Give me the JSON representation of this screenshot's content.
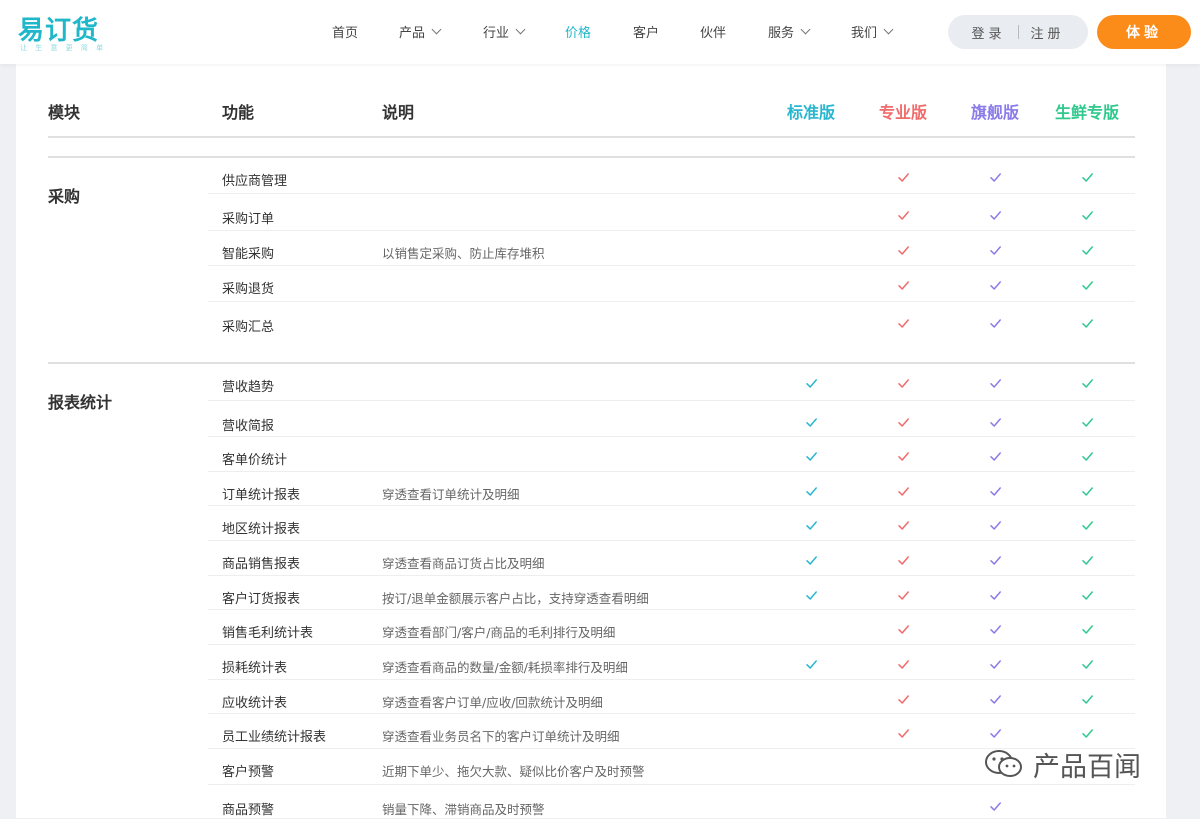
{
  "header": {
    "logo_text": "易订货",
    "logo_sub": "让 生 意 更 简 单",
    "nav": [
      {
        "label": "首页",
        "dropdown": false,
        "active": false
      },
      {
        "label": "产品",
        "dropdown": true,
        "active": false
      },
      {
        "label": "行业",
        "dropdown": true,
        "active": false
      },
      {
        "label": "价格",
        "dropdown": false,
        "active": true
      },
      {
        "label": "客户",
        "dropdown": false,
        "active": false
      },
      {
        "label": "伙伴",
        "dropdown": false,
        "active": false
      },
      {
        "label": "服务",
        "dropdown": true,
        "active": false
      },
      {
        "label": "我们",
        "dropdown": true,
        "active": false
      }
    ],
    "login_label": "登录",
    "register_label": "注册",
    "try_label": "体验"
  },
  "table": {
    "columns": {
      "module": "模块",
      "feature": "功能",
      "description": "说明"
    },
    "plans": [
      {
        "name": "标准版",
        "color": "#29b6cf"
      },
      {
        "name": "专业版",
        "color": "#f06b6b"
      },
      {
        "name": "旗舰版",
        "color": "#8b7be8"
      },
      {
        "name": "生鲜专版",
        "color": "#2fc98e"
      }
    ],
    "sections": [
      {
        "title": "采购",
        "rows": [
          {
            "feature": "供应商管理",
            "description": "",
            "plans": [
              false,
              true,
              true,
              true
            ]
          },
          {
            "feature": "采购订单",
            "description": "",
            "plans": [
              false,
              true,
              true,
              true
            ]
          },
          {
            "feature": "智能采购",
            "description": "以销售定采购、防止库存堆积",
            "plans": [
              false,
              true,
              true,
              true
            ]
          },
          {
            "feature": "采购退货",
            "description": "",
            "plans": [
              false,
              true,
              true,
              true
            ]
          },
          {
            "feature": "采购汇总",
            "description": "",
            "plans": [
              false,
              true,
              true,
              true
            ]
          }
        ]
      },
      {
        "title": "报表统计",
        "rows": [
          {
            "feature": "营收趋势",
            "description": "",
            "plans": [
              true,
              true,
              true,
              true
            ]
          },
          {
            "feature": "营收简报",
            "description": "",
            "plans": [
              true,
              true,
              true,
              true
            ]
          },
          {
            "feature": "客单价统计",
            "description": "",
            "plans": [
              true,
              true,
              true,
              true
            ]
          },
          {
            "feature": "订单统计报表",
            "description": "穿透查看订单统计及明细",
            "plans": [
              true,
              true,
              true,
              true
            ]
          },
          {
            "feature": "地区统计报表",
            "description": "",
            "plans": [
              true,
              true,
              true,
              true
            ]
          },
          {
            "feature": "商品销售报表",
            "description": "穿透查看商品订货占比及明细",
            "plans": [
              true,
              true,
              true,
              true
            ]
          },
          {
            "feature": "客户订货报表",
            "description": "按订/退单金额展示客户占比，支持穿透查看明细",
            "plans": [
              true,
              true,
              true,
              true
            ]
          },
          {
            "feature": "销售毛利统计表",
            "description": "穿透查看部门/客户/商品的毛利排行及明细",
            "plans": [
              false,
              true,
              true,
              true
            ]
          },
          {
            "feature": "损耗统计表",
            "description": "穿透查看商品的数量/金额/耗损率排行及明细",
            "plans": [
              true,
              true,
              true,
              true
            ]
          },
          {
            "feature": "应收统计表",
            "description": "穿透查看客户订单/应收/回款统计及明细",
            "plans": [
              false,
              true,
              true,
              true
            ]
          },
          {
            "feature": "员工业绩统计报表",
            "description": "穿透查看业务员名下的客户订单统计及明细",
            "plans": [
              false,
              true,
              true,
              true
            ]
          },
          {
            "feature": "客户预警",
            "description": "近期下单少、拖欠大款、疑似比价客户及时预警",
            "plans": [
              false,
              false,
              false,
              false
            ]
          },
          {
            "feature": "商品预警",
            "description": "销量下降、滞销商品及时预警",
            "plans": [
              false,
              false,
              true,
              false
            ]
          }
        ]
      }
    ]
  },
  "watermark": "产品百闻"
}
